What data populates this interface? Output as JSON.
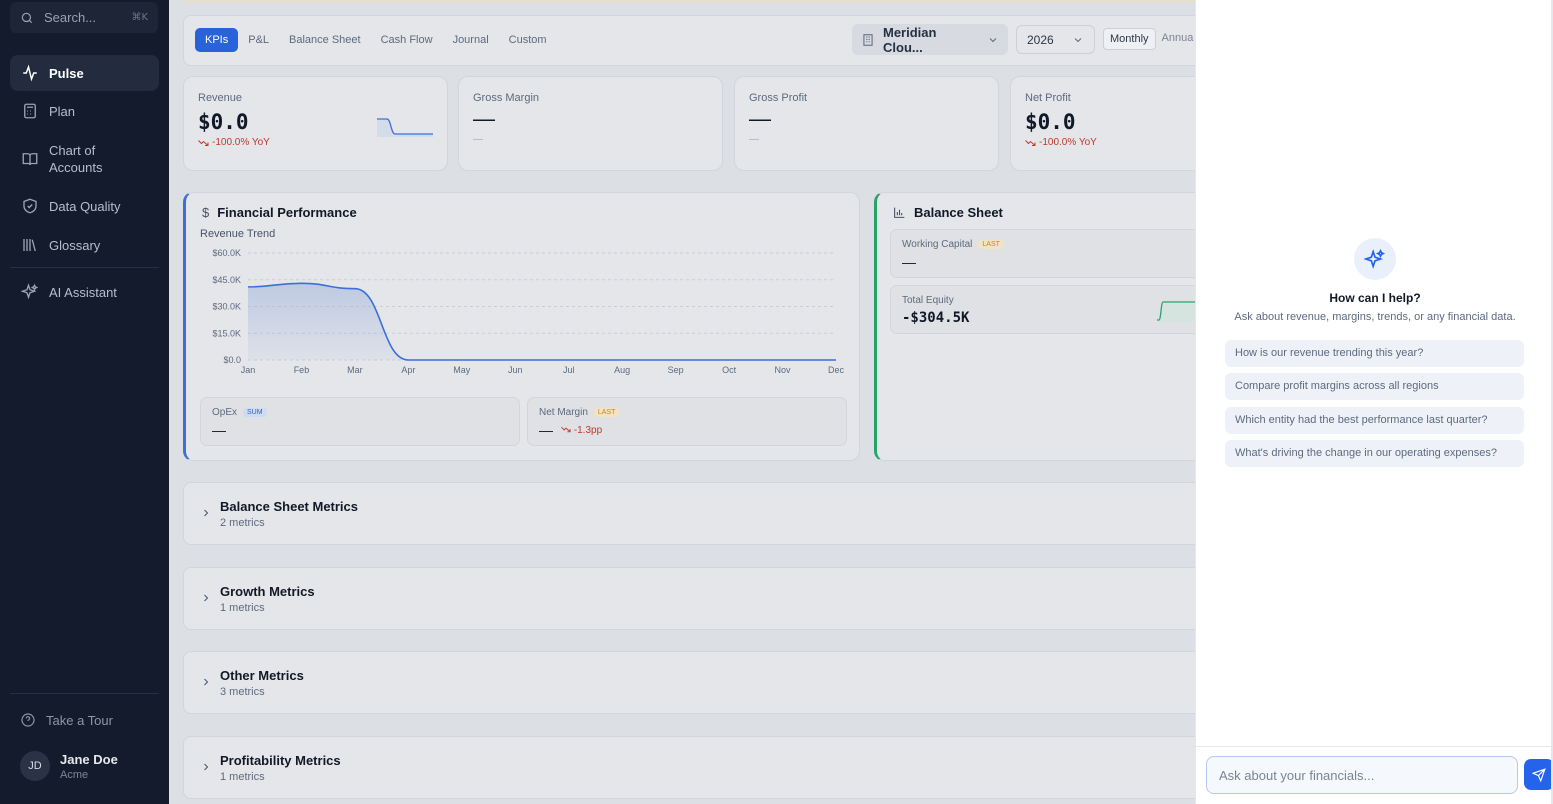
{
  "sidebar": {
    "search_placeholder": "Search...",
    "search_shortcut": "⌘K",
    "nav": [
      {
        "label": "Pulse",
        "icon": "activity-icon",
        "active": true
      },
      {
        "label": "Plan",
        "icon": "calculator-icon"
      },
      {
        "label": "Chart of Accounts",
        "icon": "book-icon"
      },
      {
        "label": "Data Quality",
        "icon": "shield-check-icon"
      },
      {
        "label": "Glossary",
        "icon": "library-icon"
      },
      {
        "label": "AI Assistant",
        "icon": "sparkles-icon"
      }
    ],
    "tour_label": "Take a Tour",
    "user": {
      "initials": "JD",
      "name": "Jane Doe",
      "org": "Acme"
    }
  },
  "toolbar": {
    "tabs": [
      "KPIs",
      "P&L",
      "Balance Sheet",
      "Cash Flow",
      "Journal",
      "Custom"
    ],
    "active_tab": "KPIs",
    "entity": "Meridian Clou...",
    "year": "2026",
    "periods": [
      "Monthly",
      "Annua"
    ],
    "active_period": "Monthly"
  },
  "kpis": [
    {
      "label": "Revenue",
      "value": "$0.0",
      "trend": "-100.0% YoY"
    },
    {
      "label": "Gross Margin",
      "value": "—",
      "sub": "—"
    },
    {
      "label": "Gross Profit",
      "value": "—",
      "sub": "—"
    },
    {
      "label": "Net Profit",
      "value": "$0.0",
      "trend": "-100.0% YoY"
    }
  ],
  "financial_performance": {
    "title": "Financial Performance",
    "chart_title": "Revenue Trend",
    "opex_label": "OpEx",
    "opex_badge": "SUM",
    "opex_value": "—",
    "net_margin_label": "Net Margin",
    "net_margin_badge": "LAST",
    "net_margin_value": "—",
    "net_margin_trend": "-1.3pp"
  },
  "chart_data": {
    "type": "area",
    "title": "Revenue Trend",
    "categories": [
      "Jan",
      "Feb",
      "Mar",
      "Apr",
      "May",
      "Jun",
      "Jul",
      "Aug",
      "Sep",
      "Oct",
      "Nov",
      "Dec"
    ],
    "values": [
      41000,
      43000,
      40000,
      0,
      0,
      0,
      0,
      0,
      0,
      0,
      0,
      0
    ],
    "yticks": [
      "$60.0K",
      "$45.0K",
      "$30.0K",
      "$15.0K",
      "$0.0"
    ],
    "ylim": [
      0,
      60000
    ],
    "grid": true,
    "color": "#3d6fd8"
  },
  "balance_sheet": {
    "title": "Balance Sheet",
    "working_capital_label": "Working Capital",
    "working_capital_badge": "LAST",
    "working_capital_value": "—",
    "total_equity_label": "Total Equity",
    "total_equity_value": "-$304.5K"
  },
  "sections": [
    {
      "title": "Balance Sheet Metrics",
      "count": "2 metrics"
    },
    {
      "title": "Growth Metrics",
      "count": "1 metrics"
    },
    {
      "title": "Other Metrics",
      "count": "3 metrics"
    },
    {
      "title": "Profitability Metrics",
      "count": "1 metrics"
    }
  ],
  "ai": {
    "title": "How can I help?",
    "subtitle": "Ask about revenue, margins, trends, or any financial data.",
    "suggestions": [
      "How is our revenue trending this year?",
      "Compare profit margins across all regions",
      "Which entity had the best performance last quarter?",
      "What's driving the change in our operating expenses?"
    ],
    "input_placeholder": "Ask about your financials..."
  },
  "colors": {
    "accent": "#2a62d9",
    "negative": "#c0392b",
    "positive": "#2aa36b",
    "sidebar": "#141b2c"
  }
}
